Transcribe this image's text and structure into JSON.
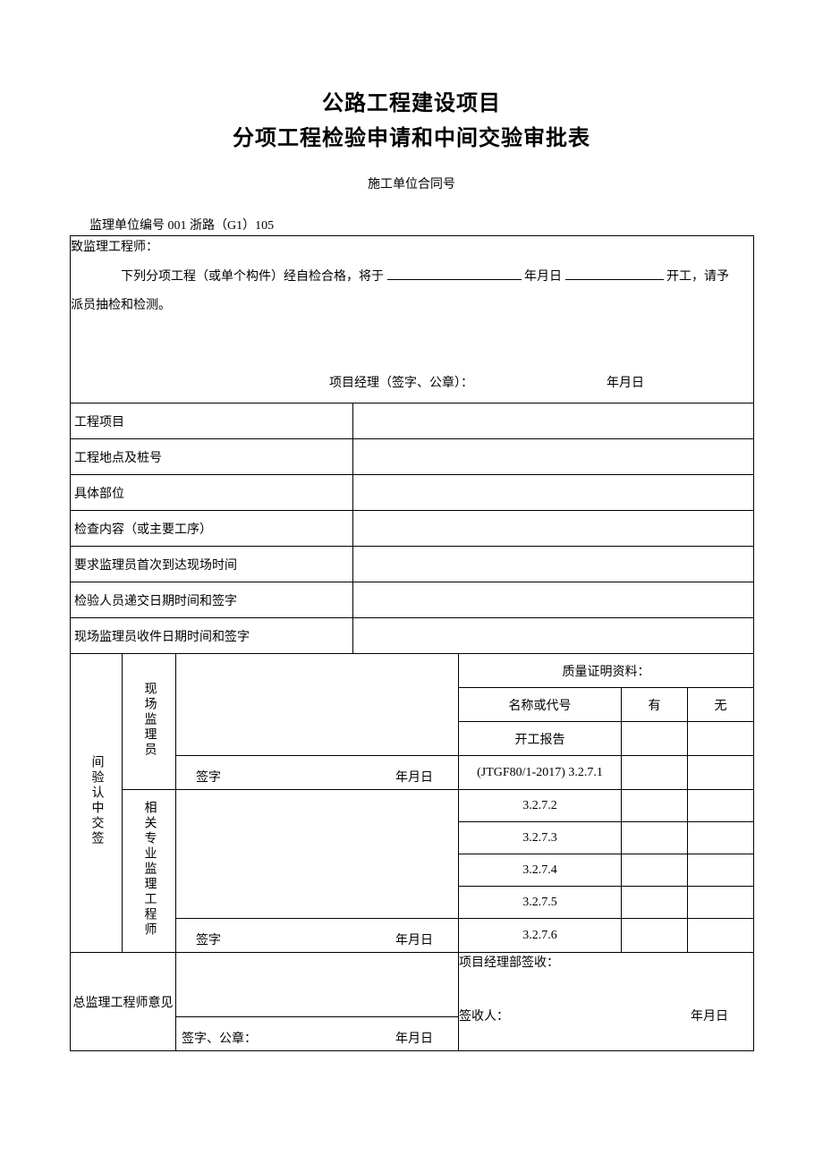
{
  "title": {
    "line1": "公路工程建设项目",
    "line2": "分项工程检验申请和中间交验审批表"
  },
  "subtitle": "施工单位合同号",
  "unit_line": "监理单位编号 001 浙路（G1）105",
  "intro": {
    "greeting": "致监理工程师：",
    "body_prefix": "下列分项工程（或单个构件）经自检合格，将于",
    "date_label": "年月日",
    "body_suffix": "开工，请予",
    "body_line2": "派员抽检和检测。",
    "pm_sign_label": "项目经理（签字、公章）：",
    "pm_date_label": "年月日"
  },
  "rows": {
    "project": "工程项目",
    "location": "工程地点及桩号",
    "part": "具体部位",
    "content": "检查内容（或主要工序）",
    "req_time": "要求监理员首次到达现场时间",
    "submit_sign": "检验人员递交日期时间和签字",
    "receive_sign": "现场监理员收件日期时间和签字"
  },
  "approval": {
    "group_label": "间验认中交签",
    "role1": "现场监理员",
    "role2": "相关专业监理工程师",
    "sign_label": "签字",
    "date_label": "年月日"
  },
  "quality": {
    "header": "质量证明资料：",
    "col_name": "名称或代号",
    "col_yes": "有",
    "col_no": "无",
    "items": [
      "开工报告",
      "(JTGF80/1-2017) 3.2.7.1",
      "3.2.7.2",
      "3.2.7.3",
      "3.2.7.4",
      "3.2.7.5",
      "3.2.7.6"
    ]
  },
  "chief": {
    "label": "总监理工程师意见",
    "sign_label": "签字、公章：",
    "date_label": "年月日"
  },
  "receipt": {
    "header": "项目经理部签收：",
    "signer_label": "签收人：",
    "date_label": "年月日"
  }
}
